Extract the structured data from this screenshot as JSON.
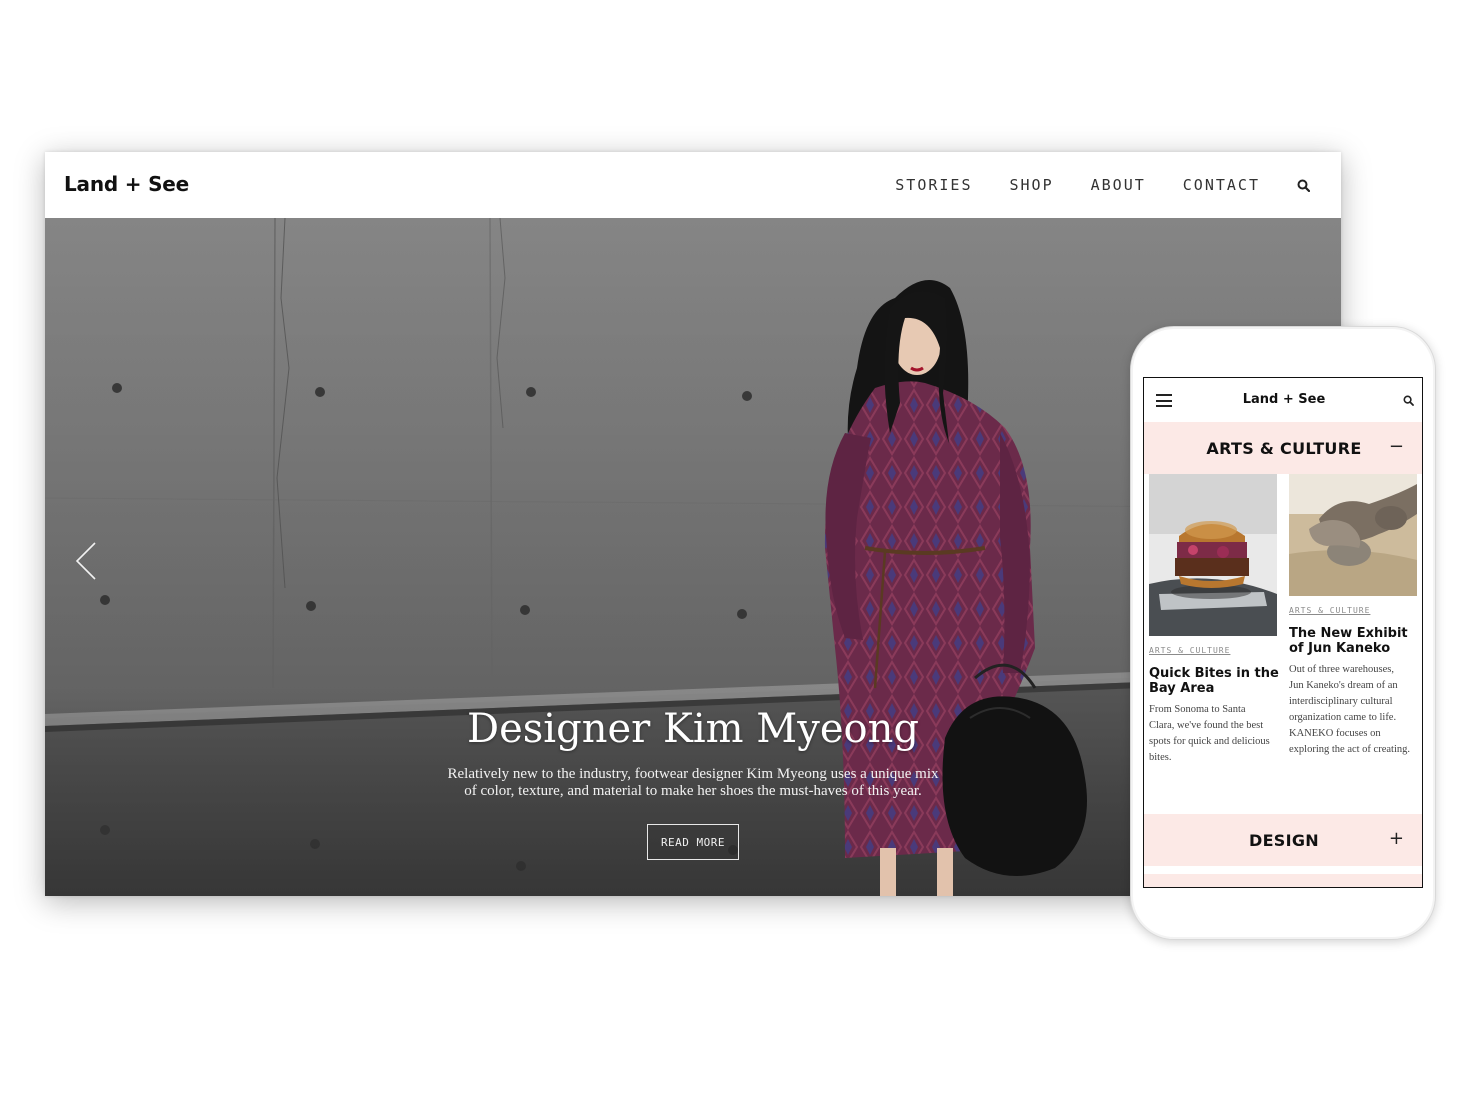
{
  "desktop": {
    "logo": "Land + See",
    "nav": [
      "STORIES",
      "SHOP",
      "ABOUT",
      "CONTACT"
    ],
    "search_icon": "search-icon",
    "hero": {
      "title": "Designer Kim Myeong",
      "description": "Relatively new to the industry, footwear designer Kim Myeong uses a unique mix of color, texture, and material to make her shoes the must-haves of this year.",
      "button": "READ MORE",
      "prev_icon": "chevron-left-icon"
    }
  },
  "mobile": {
    "logo": "Land + See",
    "menu_icon": "hamburger-icon",
    "search_icon": "search-icon",
    "sections": [
      {
        "title": "ARTS & CULTURE",
        "toggle": "−",
        "cards": [
          {
            "category": "ARTS & CULTURE",
            "title": "Quick Bites in the Bay Area",
            "text": "From Sonoma to Santa Clara, we've found the best spots for quick and delicious bites."
          },
          {
            "category": "ARTS & CULTURE",
            "title": "The New Exhibit of Jun Kaneko",
            "text": "Out of three warehouses, Jun Kaneko's dream of an interdisciplinary cultural organization came to life. KANEKO focuses on exploring the act of creating."
          }
        ]
      },
      {
        "title": "DESIGN",
        "toggle": "+"
      }
    ]
  },
  "colors": {
    "accent_pink": "#fce9e6",
    "text_dark": "#111111",
    "dress": "#6b2a4a"
  }
}
